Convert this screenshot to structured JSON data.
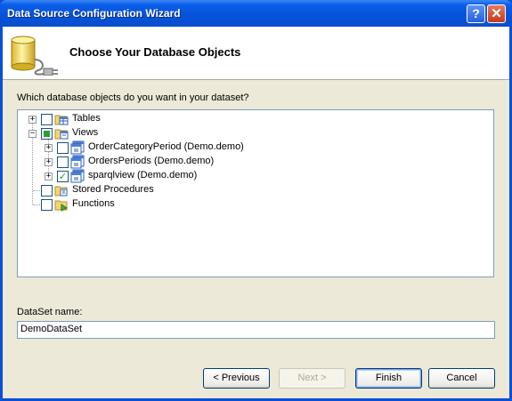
{
  "window": {
    "title": "Data Source Configuration Wizard",
    "help_glyph": "?",
    "close_glyph": "✕"
  },
  "header": {
    "title": "Choose Your Database Objects"
  },
  "question": "Which database objects do you want in your dataset?",
  "tree": {
    "tables": {
      "label": "Tables",
      "checked": false,
      "expander": "+"
    },
    "views": {
      "label": "Views",
      "state": "partial",
      "expander": "−",
      "children": [
        {
          "label": "OrderCategoryPeriod (Demo.demo)",
          "checked": false,
          "expander": "+"
        },
        {
          "label": "OrdersPeriods (Demo.demo)",
          "checked": false,
          "expander": "+"
        },
        {
          "label": "sparqlview (Demo.demo)",
          "checked": true,
          "expander": "+",
          "check_glyph": "✓"
        }
      ]
    },
    "stored_procedures": {
      "label": "Stored Procedures",
      "checked": false
    },
    "functions": {
      "label": "Functions",
      "checked": false
    }
  },
  "dataset": {
    "label": "DataSet name:",
    "value": "DemoDataSet"
  },
  "buttons": {
    "previous": "< Previous",
    "next": "Next >",
    "finish": "Finish",
    "cancel": "Cancel"
  },
  "colors": {
    "title_bar": "#0552d9",
    "dialog_bg": "#ece9d8",
    "check_green": "#21a121"
  }
}
